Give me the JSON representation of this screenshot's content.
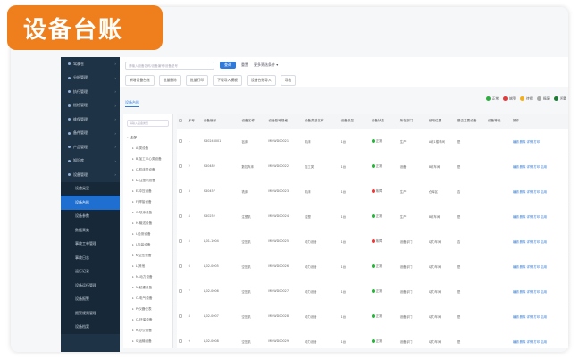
{
  "banner": {
    "title": "设备台账"
  },
  "sidebar": {
    "items": [
      {
        "label": "驾驶仓",
        "type": "top"
      },
      {
        "label": "分析管理",
        "type": "top"
      },
      {
        "label": "执行管理",
        "type": "top"
      },
      {
        "label": "巡检管理",
        "type": "top"
      },
      {
        "label": "维保管理",
        "type": "top"
      },
      {
        "label": "备件管理",
        "type": "top"
      },
      {
        "label": "产品管理",
        "type": "top"
      },
      {
        "label": "知识库",
        "type": "top"
      },
      {
        "label": "设备管理",
        "type": "top"
      },
      {
        "label": "设备类型",
        "type": "sub"
      },
      {
        "label": "设备台账",
        "type": "sub",
        "active": true
      },
      {
        "label": "设备参数",
        "type": "sub"
      },
      {
        "label": "数据采集",
        "type": "sub"
      },
      {
        "label": "事故工单管理",
        "type": "sub"
      },
      {
        "label": "事故日志",
        "type": "sub"
      },
      {
        "label": "运行记录",
        "type": "sub"
      },
      {
        "label": "设备运行管理",
        "type": "sub"
      },
      {
        "label": "设备报警",
        "type": "sub"
      },
      {
        "label": "报警规则管理",
        "type": "sub"
      },
      {
        "label": "设备档案",
        "type": "sub"
      }
    ]
  },
  "topbar": {
    "search_placeholder": "请输入设备名称/设备编号/设备型号",
    "query": "查询",
    "reset": "重置",
    "more": "更多筛选条件 ▾"
  },
  "toolbar": {
    "buttons": [
      "新增设备台账",
      "批量删除",
      "批量打印",
      "下载导入模板",
      "设备台账导入",
      "导出"
    ]
  },
  "tab": {
    "label": "设备台账"
  },
  "legend": [
    {
      "label": "正常",
      "color": "#2eae3e"
    },
    {
      "label": "故障",
      "color": "#e23b3b"
    },
    {
      "label": "待修",
      "color": "#f2b01e"
    },
    {
      "label": "报废",
      "color": "#aaaaaa"
    },
    {
      "label": "闲置",
      "color": "#1c7a33"
    }
  ],
  "tree": {
    "search_placeholder": "请输入设备类型",
    "root": "全部",
    "nodes": [
      "A-类设备",
      "B-加工中心类设备",
      "C-机床类设备",
      "D-注塑机设备",
      "E-冲压设备",
      "F-焊接设备",
      "G-喷涂设备",
      "H-输送设备",
      "I-检测设备",
      "J-包装设备",
      "K-空压设备",
      "L-其他",
      "M-动力设备",
      "N-起重设备",
      "O-电气设备",
      "P-仪器仪表",
      "Q-环保设备",
      "R-办公设备",
      "S-运输设备",
      "T-其他设备"
    ]
  },
  "table": {
    "headers": [
      "",
      "序号",
      "设备编号",
      "设备名称",
      "设备型号规格",
      "设备类型名称",
      "设备数量",
      "设备状态",
      "所在部门",
      "使用位置",
      "是否主要设备",
      "设备等级",
      "操作"
    ],
    "rows": [
      {
        "no": "1",
        "code": "SB0246001",
        "name": "钻床",
        "model": "MMWD00021",
        "type": "机床",
        "qty": "1台",
        "status": "正常",
        "status_color": "#2eae3e",
        "dept": "生产",
        "loc": "A栋1楼车间",
        "main": "是",
        "grade": "",
        "ops": "编辑 删除 详情 打印"
      },
      {
        "no": "2",
        "code": "SB0482",
        "name": "数控车床",
        "model": "MMWD00022",
        "type": "加工类",
        "qty": "1台",
        "status": "正常",
        "status_color": "#2eae3e",
        "dept": "设备",
        "loc": "B栋车间",
        "main": "是",
        "grade": "",
        "ops": "编辑 删除 详情 打印 启用"
      },
      {
        "no": "3",
        "code": "SB0457",
        "name": "铣床",
        "model": "MMWD00023",
        "type": "机床",
        "qty": "1台",
        "status": "故障",
        "status_color": "#e23b3b",
        "dept": "生产",
        "loc": "仓库区",
        "main": "否",
        "grade": "",
        "ops": "编辑 删除 详情 打印 启用"
      },
      {
        "no": "4",
        "code": "SB0252",
        "name": "注塑机",
        "model": "MMWD00024",
        "type": "注塑",
        "qty": "1台",
        "status": "正常",
        "status_color": "#2eae3e",
        "dept": "生产",
        "loc": "B栋车间",
        "main": "是",
        "grade": "",
        "ops": "编辑 删除 详情 打印 启用"
      },
      {
        "no": "5",
        "code": "LJ01-1004",
        "name": "空压机",
        "model": "MMWD00025",
        "type": "动力设备",
        "qty": "1台",
        "status": "故障",
        "status_color": "#e23b3b",
        "dept": "设备部门",
        "loc": "动力车间",
        "main": "否",
        "grade": "",
        "ops": "编辑 删除 详情 打印 启用"
      },
      {
        "no": "6",
        "code": "LJ02-0005",
        "name": "空压机",
        "model": "MMWD00026",
        "type": "动力设备",
        "qty": "1台",
        "status": "正常",
        "status_color": "#2eae3e",
        "dept": "设备部门",
        "loc": "动力车间",
        "main": "是",
        "grade": "",
        "ops": "编辑 删除 详情 打印 启用"
      },
      {
        "no": "7",
        "code": "LJ02-0006",
        "name": "空压机",
        "model": "MMWD00027",
        "type": "动力设备",
        "qty": "1台",
        "status": "正常",
        "status_color": "#2eae3e",
        "dept": "设备部门",
        "loc": "动力车间",
        "main": "是",
        "grade": "",
        "ops": "编辑 删除 详情 打印 启用"
      },
      {
        "no": "8",
        "code": "LJ02-0007",
        "name": "空压机",
        "model": "MMWD00028",
        "type": "动力设备",
        "qty": "1台",
        "status": "正常",
        "status_color": "#2eae3e",
        "dept": "设备部门",
        "loc": "动力车间",
        "main": "是",
        "grade": "",
        "ops": "编辑 删除 详情 打印 启用"
      },
      {
        "no": "9",
        "code": "LJ02-0008",
        "name": "空压机",
        "model": "MMWD00029",
        "type": "动力设备",
        "qty": "1台",
        "status": "正常",
        "status_color": "#2eae3e",
        "dept": "设备部门",
        "loc": "动力车间",
        "main": "是",
        "grade": "",
        "ops": "编辑 删除 详情 打印 启用"
      }
    ]
  }
}
